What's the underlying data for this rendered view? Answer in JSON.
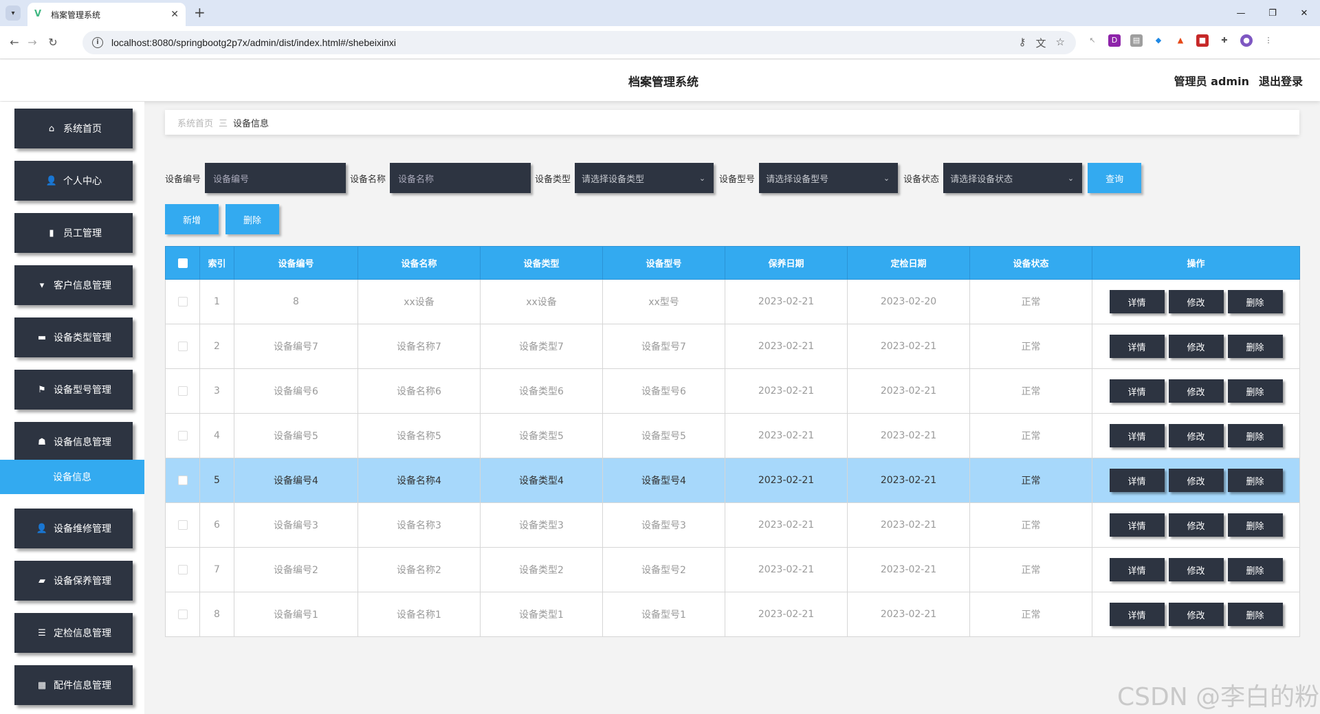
{
  "browser": {
    "tab_title": "档案管理系统",
    "url": "localhost:8080/springbootg2p7x/admin/dist/index.html#/shebeixinxi"
  },
  "header": {
    "title": "档案管理系统",
    "user_label": "管理员 admin",
    "logout_label": "退出登录"
  },
  "sidebar": {
    "items": [
      {
        "label": "系统首页",
        "icon": "home-icon"
      },
      {
        "label": "个人中心",
        "icon": "user-icon"
      },
      {
        "label": "员工管理",
        "icon": "id-card-icon"
      },
      {
        "label": "客户信息管理",
        "icon": "bookmark-icon"
      },
      {
        "label": "设备类型管理",
        "icon": "book-icon"
      },
      {
        "label": "设备型号管理",
        "icon": "flag-icon"
      },
      {
        "label": "设备信息管理",
        "icon": "thumb-icon"
      },
      {
        "label": "设备维修管理",
        "icon": "user-icon"
      },
      {
        "label": "设备保养管理",
        "icon": "ticket-icon"
      },
      {
        "label": "定检信息管理",
        "icon": "list-icon"
      },
      {
        "label": "配件信息管理",
        "icon": "grid-icon"
      }
    ],
    "active_submenu": "设备信息"
  },
  "breadcrumb": {
    "home": "系统首页",
    "separator": "三",
    "current": "设备信息"
  },
  "search": {
    "fields": [
      {
        "label": "设备编号",
        "placeholder": "设备编号"
      },
      {
        "label": "设备名称",
        "placeholder": "设备名称"
      }
    ],
    "selects": [
      {
        "label": "设备类型",
        "placeholder": "请选择设备类型"
      },
      {
        "label": "设备型号",
        "placeholder": "请选择设备型号"
      },
      {
        "label": "设备状态",
        "placeholder": "请选择设备状态"
      }
    ],
    "query_label": "查询"
  },
  "actions": {
    "add_label": "新增",
    "delete_label": "删除"
  },
  "table": {
    "columns": [
      "索引",
      "设备编号",
      "设备名称",
      "设备类型",
      "设备型号",
      "保养日期",
      "定检日期",
      "设备状态",
      "操作"
    ],
    "op_labels": [
      "详情",
      "修改",
      "删除"
    ],
    "selected_index": 4,
    "rows": [
      [
        "1",
        "8",
        "xx设备",
        "xx设备",
        "xx型号",
        "2023-02-21",
        "2023-02-20",
        "正常"
      ],
      [
        "2",
        "设备编号7",
        "设备名称7",
        "设备类型7",
        "设备型号7",
        "2023-02-21",
        "2023-02-21",
        "正常"
      ],
      [
        "3",
        "设备编号6",
        "设备名称6",
        "设备类型6",
        "设备型号6",
        "2023-02-21",
        "2023-02-21",
        "正常"
      ],
      [
        "4",
        "设备编号5",
        "设备名称5",
        "设备类型5",
        "设备型号5",
        "2023-02-21",
        "2023-02-21",
        "正常"
      ],
      [
        "5",
        "设备编号4",
        "设备名称4",
        "设备类型4",
        "设备型号4",
        "2023-02-21",
        "2023-02-21",
        "正常"
      ],
      [
        "6",
        "设备编号3",
        "设备名称3",
        "设备类型3",
        "设备型号3",
        "2023-02-21",
        "2023-02-21",
        "正常"
      ],
      [
        "7",
        "设备编号2",
        "设备名称2",
        "设备类型2",
        "设备型号2",
        "2023-02-21",
        "2023-02-21",
        "正常"
      ],
      [
        "8",
        "设备编号1",
        "设备名称1",
        "设备类型1",
        "设备型号1",
        "2023-02-21",
        "2023-02-21",
        "正常"
      ]
    ]
  },
  "watermark": "CSDN @李白的粉",
  "colors": {
    "accent": "#33aaf0",
    "dark": "#2d3441",
    "selected_row": "#a7d8fb"
  }
}
